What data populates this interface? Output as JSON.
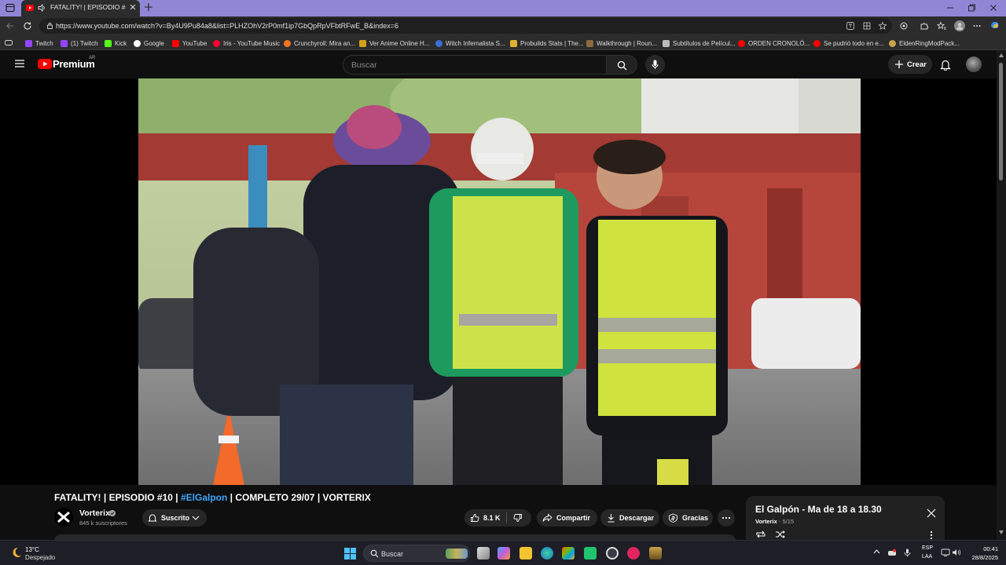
{
  "browser": {
    "tab_title": "FATALITY! | EPISODIO #10 | #ElGalpon | COMPLETO 29/07 | VORTERIX",
    "url": "https://www.youtube.com/watch?v=By4U9Pu84a8&list=PLHZOhV2rP0mf1ip7GbQpRpVFbtRFwE_B&index=6",
    "bookmarks": [
      {
        "label": "Twitch",
        "color": "#9146ff"
      },
      {
        "label": "(1) Twitch",
        "color": "#9146ff"
      },
      {
        "label": "Kick",
        "color": "#53fc18"
      },
      {
        "label": "Google",
        "color": "#4285f4"
      },
      {
        "label": "YouTube",
        "color": "#ff0000"
      },
      {
        "label": "Iris - YouTube Music",
        "color": "#ff0033"
      },
      {
        "label": "Crunchyroll: Mira an...",
        "color": "#f47521"
      },
      {
        "label": "Ver Anime Online H...",
        "color": "#d4a017"
      },
      {
        "label": "Witch Infernalista S...",
        "color": "#3b6fd8"
      },
      {
        "label": "Probuilds Stats | The...",
        "color": "#e0b030"
      },
      {
        "label": "Walkthrough | Roun...",
        "color": "#8b6a3e"
      },
      {
        "label": "Subtítulos de Películ...",
        "color": "#bbbbbb"
      },
      {
        "label": "ORDEN CRONOLÓ...",
        "color": "#ff0000"
      },
      {
        "label": "Se pudrió todo en e...",
        "color": "#ff0000"
      },
      {
        "label": "EldenRingModPack...",
        "color": "#c9a44a"
      }
    ]
  },
  "youtube": {
    "logo_text": "Premium",
    "country_code": "AR",
    "search_placeholder": "Buscar",
    "create_label": "Crear",
    "video": {
      "title_prefix": "FATALITY! | EPISODIO #10 | ",
      "title_tag": "#ElGalpon",
      "title_suffix": " | COMPLETO 29/07 | VORTERIX",
      "channel_name": "Vorterix",
      "subscribers": "845 k suscriptores",
      "subscribe_label": "Suscrito",
      "likes": "8.1 K",
      "share_label": "Compartir",
      "download_label": "Descargar",
      "thanks_label": "Gracias"
    },
    "playlist": {
      "title": "El Galpón - Ma de 18 a 18.30",
      "channel": "Vorterix",
      "position": "5/15"
    }
  },
  "taskbar": {
    "temperature": "13°C",
    "weather": "Despejado",
    "search_label": "Buscar",
    "lang_line1": "ESP",
    "lang_line2": "LAA",
    "time": "00:41",
    "date": "28/8/2025"
  },
  "colors": {
    "youtube_red": "#ff0000",
    "link_blue": "#3ea6ff",
    "tab_bar": "#8f86d6"
  }
}
